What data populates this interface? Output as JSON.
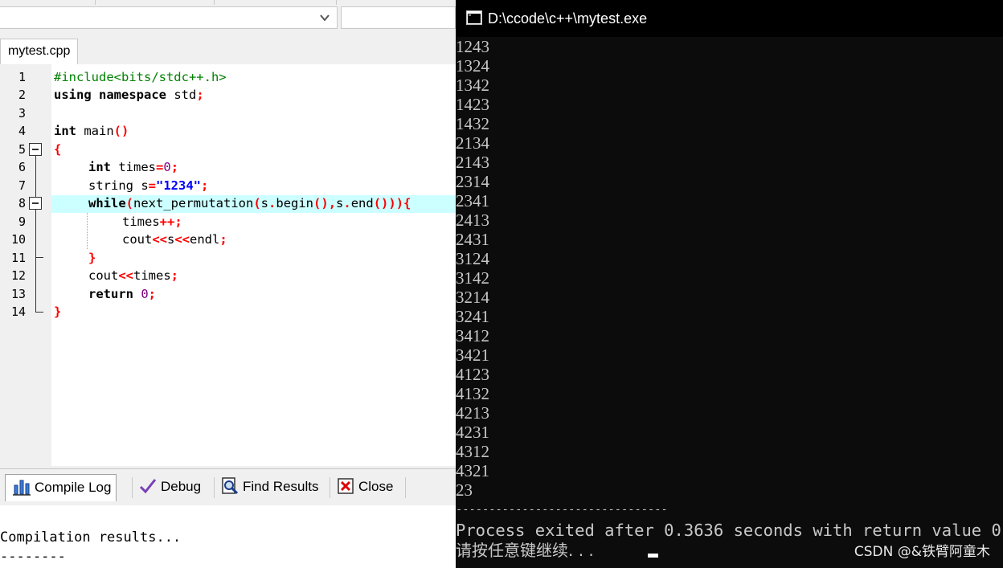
{
  "ide": {
    "file_tab": "mytest.cpp",
    "line_numbers": [
      "1",
      "2",
      "3",
      "4",
      "5",
      "6",
      "7",
      "8",
      "9",
      "10",
      "11",
      "12",
      "13",
      "14"
    ],
    "code": {
      "l1": "#include<bits/stdc++.h>",
      "l2_kw": "using namespace",
      "l2_id": " std",
      "l2_semi": ";",
      "l4_kw": "int",
      "l4_id": " main",
      "l4_paren": "()",
      "l5": "{",
      "l6_kw": "int",
      "l6_id": " times",
      "l6_eq": "=",
      "l6_num": "0",
      "l6_semi": ";",
      "l7_id": "string s",
      "l7_eq": "=",
      "l7_str": "\"1234\"",
      "l7_semi": ";",
      "l8_kw": "while",
      "l8_p1": "(",
      "l8_id1": "next_permutation",
      "l8_p2": "(",
      "l8_id2": "s",
      "l8_dot1": ".",
      "l8_id3": "begin",
      "l8_p3": "(),",
      "l8_id4": "s",
      "l8_dot2": ".",
      "l8_id5": "end",
      "l8_p4": "())){",
      "l9_id": "times",
      "l9_op": "++;",
      "l10_id1": "cout",
      "l10_op1": "<<",
      "l10_id2": "s",
      "l10_op2": "<<",
      "l10_id3": "endl",
      "l10_semi": ";",
      "l11": "}",
      "l12_id1": "cout",
      "l12_op": "<<",
      "l12_id2": "times",
      "l12_semi": ";",
      "l13_kw": "return",
      "l13_num": " 0",
      "l13_semi": ";",
      "l14": "}"
    },
    "panel_tabs": {
      "compile_log": "Compile Log",
      "debug": "Debug",
      "find_results": "Find Results",
      "close": "Close"
    },
    "log_lines": [
      "Compilation results...",
      "--------"
    ]
  },
  "console": {
    "title": "D:\\ccode\\c++\\mytest.exe",
    "output_lines": [
      "1243",
      "1324",
      "1342",
      "1423",
      "1432",
      "2134",
      "2143",
      "2314",
      "2341",
      "2413",
      "2431",
      "3124",
      "3142",
      "3214",
      "3241",
      "3412",
      "3421",
      "4123",
      "4132",
      "4213",
      "4231",
      "4312",
      "4321",
      "23"
    ],
    "separator": "--------------------------------",
    "process_line": "Process exited after 0.3636 seconds with return value 0",
    "press_any_key": "请按任意键继续. . .",
    "watermark": "CSDN @&铁臂阿童木"
  }
}
